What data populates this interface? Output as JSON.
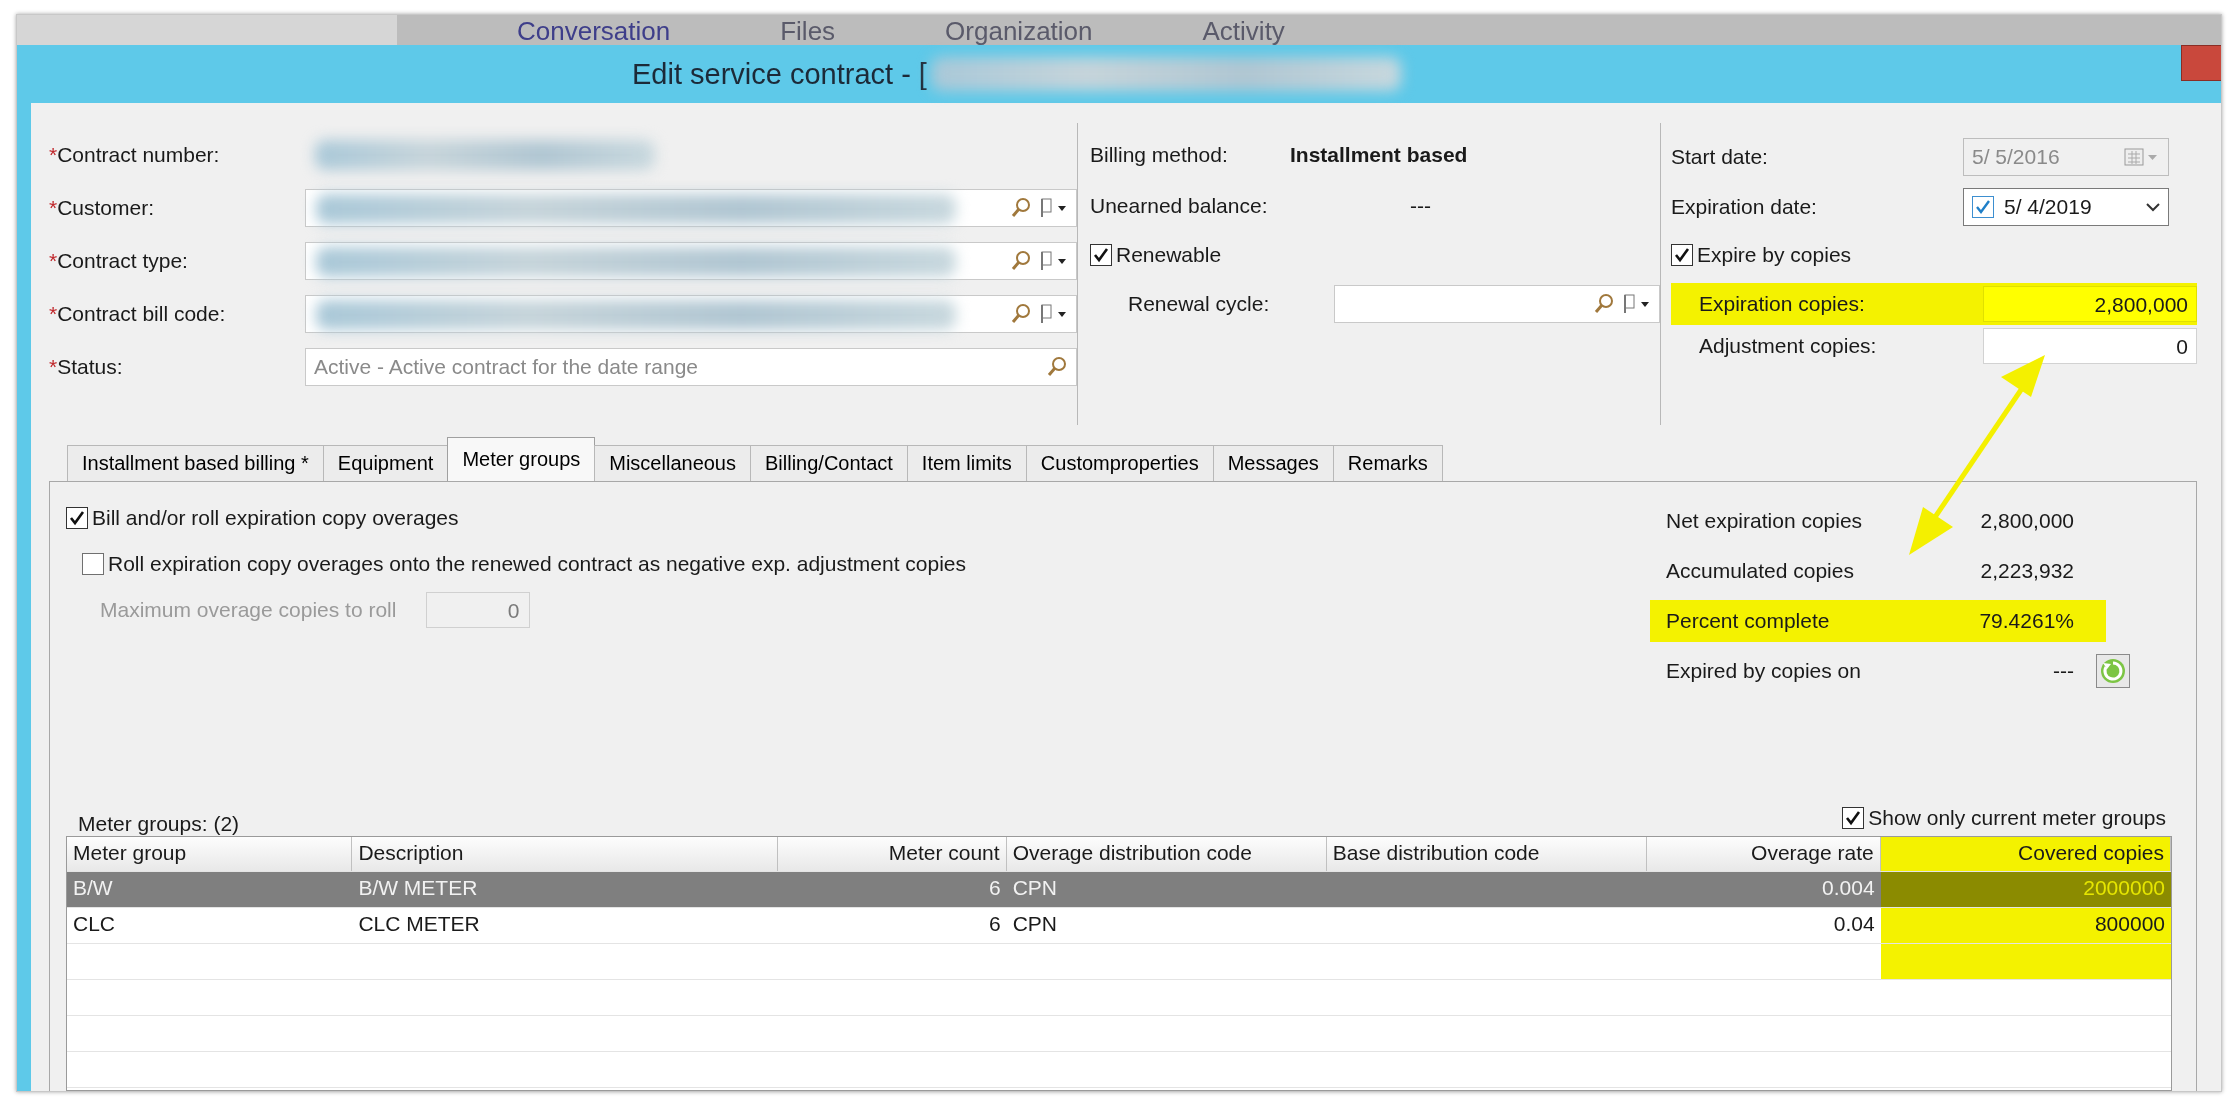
{
  "top_nav": {
    "items": [
      "Conversation",
      "Files",
      "Organization",
      "Activity"
    ]
  },
  "window": {
    "title": "Edit service contract - ["
  },
  "left_fields": [
    {
      "marker": "*",
      "label": "Contract number:",
      "kind": "static",
      "redacted": true
    },
    {
      "marker": "*",
      "label": "Customer:",
      "kind": "lookup",
      "redacted": true
    },
    {
      "marker": "*",
      "label": "Contract type:",
      "kind": "lookup",
      "redacted": true
    },
    {
      "marker": "*",
      "label": "Contract bill code:",
      "kind": "lookup",
      "redacted": true
    },
    {
      "marker": "*",
      "label": "Status:",
      "kind": "search",
      "value": "Active - Active contract for the date range"
    }
  ],
  "billing_method": {
    "label": "Billing method:",
    "value": "Installment based"
  },
  "unearned_balance": {
    "label": "Unearned balance:",
    "value": "---"
  },
  "renewable": {
    "label": "Renewable",
    "checked": true
  },
  "renewal_cycle": {
    "label": "Renewal cycle:"
  },
  "start_date": {
    "label": "Start date:",
    "value": "5/ 5/2016",
    "disabled": true
  },
  "expiration_date": {
    "label": "Expiration date:",
    "value": "5/ 4/2019",
    "checked": true
  },
  "expire_by_copies": {
    "label": "Expire by copies",
    "checked": true
  },
  "copies_fields": [
    {
      "label": "Expiration copies:",
      "value": "2,800,000",
      "highlighted": true
    },
    {
      "label": "Adjustment copies:",
      "value": "0",
      "highlighted": false
    }
  ],
  "tabs": [
    {
      "label": "Installment based billing *",
      "selected": false
    },
    {
      "label": "Equipment",
      "selected": false
    },
    {
      "label": "Meter groups",
      "selected": true
    },
    {
      "label": "Miscellaneous",
      "selected": false
    },
    {
      "label": "Billing/Contact",
      "selected": false
    },
    {
      "label": "Item limits",
      "selected": false
    },
    {
      "label": "Customproperties",
      "selected": false
    },
    {
      "label": "Messages",
      "selected": false
    },
    {
      "label": "Remarks",
      "selected": false
    }
  ],
  "options": [
    {
      "label": "Bill and/or roll expiration copy overages",
      "checked": true,
      "kind": "primary"
    },
    {
      "label": "Roll expiration copy overages onto the renewed contract as negative exp. adjustment copies",
      "checked": false,
      "kind": "sub"
    }
  ],
  "max_overage": {
    "label": "Maximum overage copies to roll",
    "value": "0",
    "disabled": true
  },
  "stats": [
    {
      "label": "Net expiration copies",
      "value": "2,800,000",
      "highlighted": false
    },
    {
      "label": "Accumulated copies",
      "value": "2,223,932",
      "highlighted": false
    },
    {
      "label": "Percent complete",
      "value": "79.4261%",
      "highlighted": true
    },
    {
      "label": "Expired by copies on",
      "value": "---",
      "highlighted": false
    }
  ],
  "meter_groups": {
    "title": "Meter groups: (2)",
    "show_current": {
      "label": "Show only current meter groups",
      "checked": true
    },
    "columns": [
      {
        "label": "Meter group",
        "kind": "text",
        "highlighted": false
      },
      {
        "label": "Description",
        "kind": "text",
        "highlighted": false
      },
      {
        "label": "Meter count",
        "kind": "number",
        "highlighted": false
      },
      {
        "label": "Overage distribution code",
        "kind": "text",
        "highlighted": false
      },
      {
        "label": "Base distribution code",
        "kind": "text",
        "highlighted": false
      },
      {
        "label": "Overage rate",
        "kind": "number",
        "highlighted": false
      },
      {
        "label": "Covered copies",
        "kind": "number",
        "highlighted": true
      }
    ],
    "rows": [
      {
        "cells": [
          "B/W",
          "B/W METER",
          "6",
          "CPN",
          "",
          "0.004",
          "2000000"
        ],
        "selected": true
      },
      {
        "cells": [
          "CLC",
          "CLC METER",
          "6",
          "CPN",
          "",
          "0.04",
          "800000"
        ],
        "selected": false
      }
    ]
  }
}
